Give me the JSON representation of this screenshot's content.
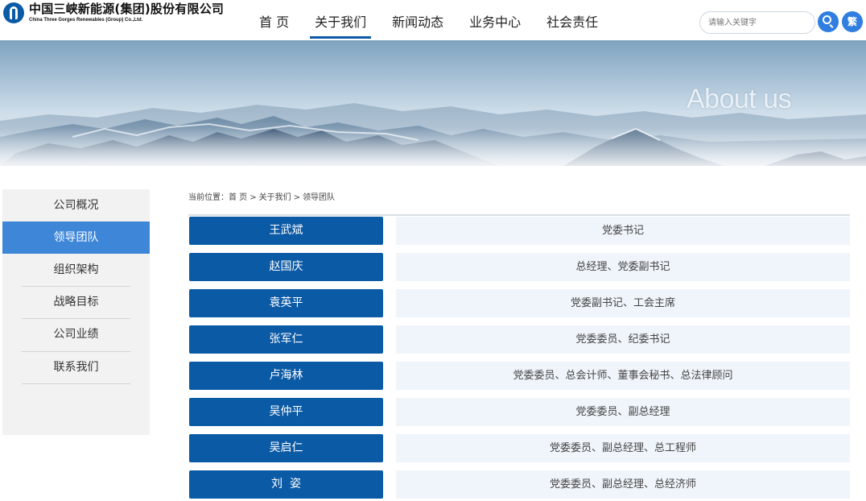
{
  "header": {
    "logo_cn": "中国三峡新能源(集团)股份有限公司",
    "logo_en": "China Three Gorges Renewables (Group) Co.,Ltd.",
    "nav": [
      {
        "label": "首 页",
        "active": false
      },
      {
        "label": "关于我们",
        "active": true
      },
      {
        "label": "新闻动态",
        "active": false
      },
      {
        "label": "业务中心",
        "active": false
      },
      {
        "label": "社会责任",
        "active": false
      }
    ],
    "search_placeholder": "请输入关键字",
    "trad_label": "繁",
    "accent_color": "#0b5aa6"
  },
  "banner": {
    "title": "About us"
  },
  "sidebar": {
    "items": [
      {
        "label": "公司概况",
        "active": false
      },
      {
        "label": "领导团队",
        "active": true
      },
      {
        "label": "组织架构",
        "active": false
      },
      {
        "label": "战略目标",
        "active": false
      },
      {
        "label": "公司业绩",
        "active": false
      },
      {
        "label": "联系我们",
        "active": false
      }
    ]
  },
  "breadcrumb": {
    "prefix": "当前位置：",
    "items": [
      "首 页",
      "关于我们",
      "领导团队"
    ],
    "separator": ">"
  },
  "leaders": [
    {
      "name": "王武斌",
      "title": "党委书记"
    },
    {
      "name": "赵国庆",
      "title": "总经理、党委副书记"
    },
    {
      "name": "袁英平",
      "title": "党委副书记、工会主席"
    },
    {
      "name": "张军仁",
      "title": "党委委员、纪委书记"
    },
    {
      "name": "卢海林",
      "title": "党委委员、总会计师、董事会秘书、总法律顾问"
    },
    {
      "name": "吴仲平",
      "title": "党委委员、副总经理"
    },
    {
      "name": "吴启仁",
      "title": "党委委员、副总经理、总工程师"
    },
    {
      "name": "刘  姿",
      "title": "党委委员、副总经理、总经济师"
    }
  ]
}
